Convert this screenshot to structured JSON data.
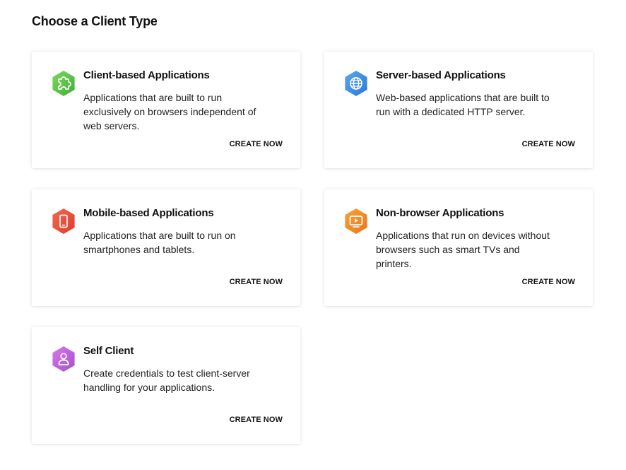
{
  "page": {
    "title": "Choose a Client Type"
  },
  "cards": [
    {
      "id": "client",
      "title": "Client-based Applications",
      "description": "Applications that are built to run exclusively on browsers independent of web servers.",
      "cta": "CREATE NOW",
      "icon": "puzzle-icon",
      "color": "#5cc04a"
    },
    {
      "id": "server",
      "title": "Server-based Applications",
      "description": "Web-based applications that are built to run with a dedicated HTTP server.",
      "cta": "CREATE NOW",
      "icon": "globe-icon",
      "color": "#3b8fe3"
    },
    {
      "id": "mobile",
      "title": "Mobile-based Applications",
      "description": "Applications that are built to run on smartphones and tablets.",
      "cta": "CREATE NOW",
      "icon": "smartphone-icon",
      "color": "#e8503a"
    },
    {
      "id": "nonbrowser",
      "title": "Non-browser Applications",
      "description": "Applications that run on devices without browsers such as smart TVs and printers.",
      "cta": "CREATE NOW",
      "icon": "tv-icon",
      "color": "#ef8a1f"
    },
    {
      "id": "self",
      "title": "Self Client",
      "description": "Create credentials to test client-server handling for your applications.",
      "cta": "CREATE NOW",
      "icon": "user-icon",
      "color": "#b55fd6"
    }
  ]
}
